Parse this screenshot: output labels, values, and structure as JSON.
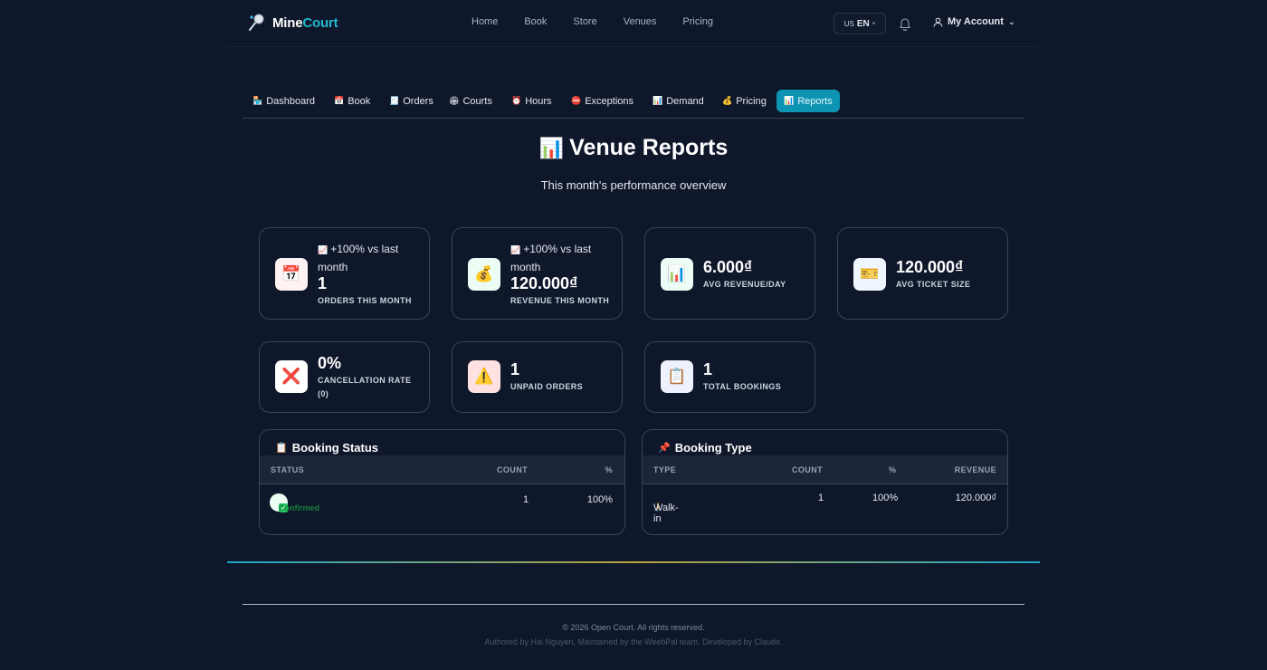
{
  "brand": {
    "name_part1": "Mine",
    "name_part2": "Court"
  },
  "nav": {
    "items": [
      "Home",
      "Book",
      "Store",
      "Venues",
      "Pricing"
    ]
  },
  "language": {
    "flag": "US",
    "code": "EN"
  },
  "account": {
    "label": "My Account"
  },
  "tabs": [
    {
      "icon": "🏪",
      "label": "Dashboard"
    },
    {
      "icon": "📅",
      "label": "Book"
    },
    {
      "icon": "🧾",
      "label": "Orders"
    },
    {
      "icon": "🏟",
      "label": "Courts"
    },
    {
      "icon": "⏰",
      "label": "Hours"
    },
    {
      "icon": "⛔",
      "label": "Exceptions"
    },
    {
      "icon": "📊",
      "label": "Demand"
    },
    {
      "icon": "💰",
      "label": "Pricing"
    },
    {
      "icon": "📊",
      "label": "Reports"
    }
  ],
  "page": {
    "title": "Venue Reports",
    "title_icon": "📊",
    "subtitle": "This month's performance overview"
  },
  "stats": [
    {
      "icon": "📅",
      "trend_icon": "📈",
      "trend": "+100% vs last month",
      "value": "1",
      "label": "ORDERS THIS MONTH"
    },
    {
      "icon": "💰",
      "trend_icon": "📈",
      "trend": "+100% vs last month",
      "value": "120.000₫",
      "label": "REVENUE THIS MONTH"
    },
    {
      "icon": "📊",
      "value": "6.000₫",
      "label": "AVG REVENUE/DAY"
    },
    {
      "icon": "🎫",
      "value": "120.000₫",
      "label": "AVG TICKET SIZE"
    },
    {
      "icon": "❌",
      "value": "0%",
      "label": "CANCELLATION RATE (0)"
    },
    {
      "icon": "⚠️",
      "value": "1",
      "label": "UNPAID ORDERS"
    },
    {
      "icon": "📋",
      "value": "1",
      "label": "TOTAL BOOKINGS"
    }
  ],
  "booking_status": {
    "title": "Booking Status",
    "title_icon": "📋",
    "headers": [
      "STATUS",
      "COUNT",
      "%"
    ],
    "rows": [
      {
        "status": "Confirmed",
        "count": "1",
        "pct": "100%"
      }
    ]
  },
  "booking_type": {
    "title": "Booking Type",
    "title_icon": "📌",
    "headers": [
      "TYPE",
      "COUNT",
      "%",
      "REVENUE"
    ],
    "rows": [
      {
        "icon": "🚶",
        "type": "Walk-in",
        "count": "1",
        "pct": "100%",
        "revenue": "120.000₫"
      }
    ]
  },
  "footer": {
    "copyright": "© 2026 Open Court. All rights reserved.",
    "credits": "Authored by Hai Nguyen, Maintained by the WeebPal team, Developed by Claude."
  },
  "colors": {
    "background": "#0f172a",
    "accent": "#0e94b3",
    "brand_accent": "#22b8cf"
  }
}
